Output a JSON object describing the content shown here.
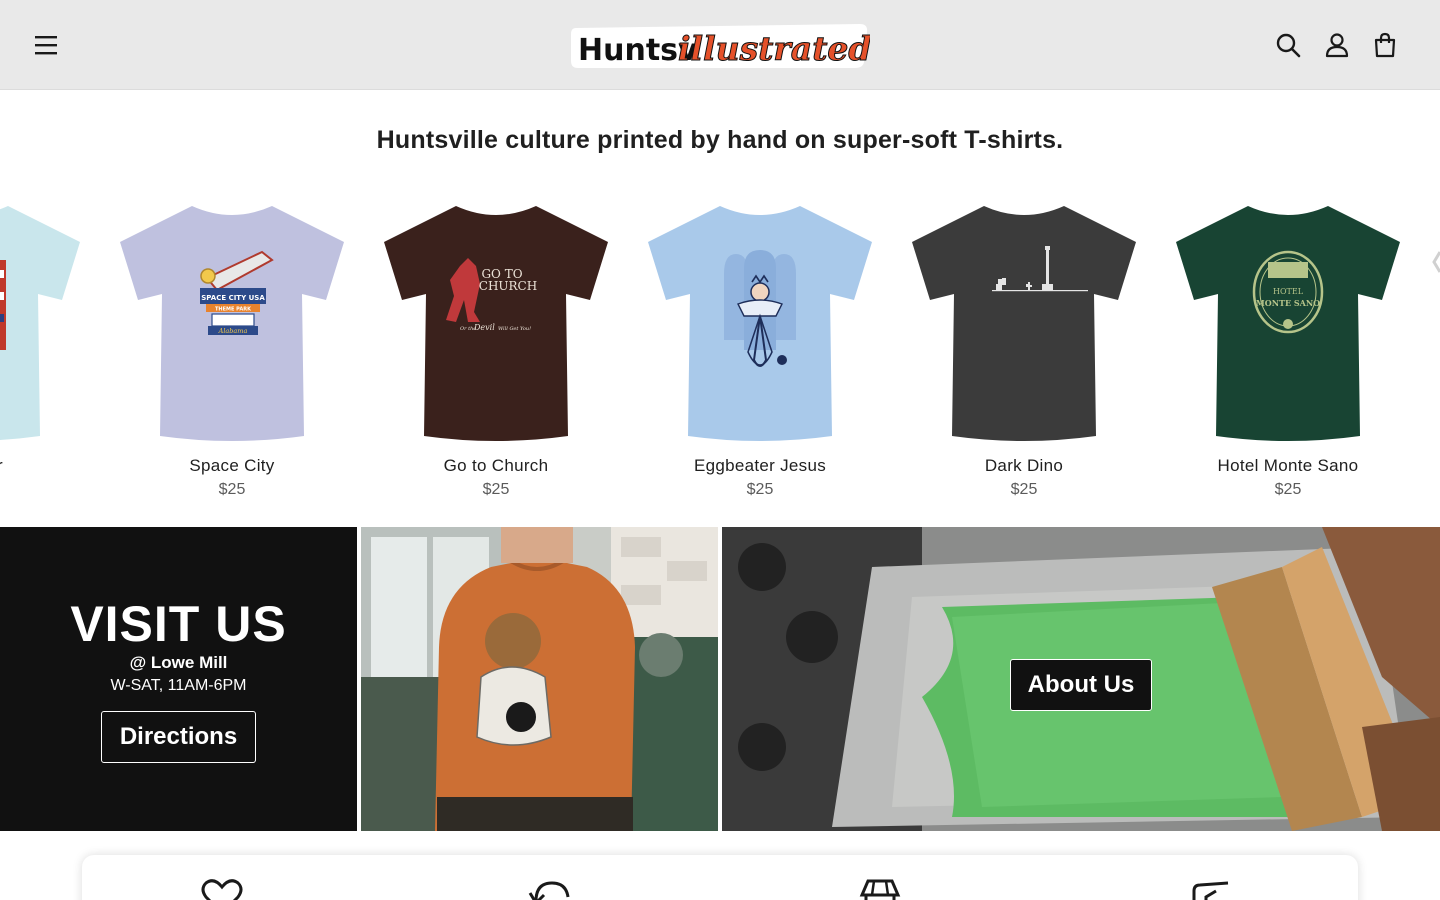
{
  "header": {
    "menu_icon": "hamburger-menu-icon",
    "logo_text_plain": "Huntsv",
    "logo_text_script": "illustrated",
    "icons": [
      "search-icon",
      "account-icon",
      "cart-icon"
    ]
  },
  "tagline": "Huntsville culture printed by hand on super-soft T-shirts.",
  "products": [
    {
      "name": "er",
      "price": "",
      "shirt_color": "#c9e6ec"
    },
    {
      "name": "Space City",
      "price": "$25",
      "shirt_color": "#bfc1df"
    },
    {
      "name": "Go to Church",
      "price": "$25",
      "shirt_color": "#3a211c"
    },
    {
      "name": "Eggbeater Jesus",
      "price": "$25",
      "shirt_color": "#a9c9ea"
    },
    {
      "name": "Dark Dino",
      "price": "$25",
      "shirt_color": "#3b3b3b"
    },
    {
      "name": "Hotel Monte Sano",
      "price": "$25",
      "shirt_color": "#184433"
    }
  ],
  "shirt_graphics": {
    "space_city": [
      "SPACE CITY USA",
      "THEME PARK",
      "Alabama"
    ],
    "go_to_church": [
      "GO TO",
      "CHURCH",
      "Or the",
      "Devil",
      "Will Get You!"
    ],
    "hotel_monte_sano": [
      "HOTEL",
      "MONTE SANO"
    ]
  },
  "visit": {
    "title": "VISIT US",
    "location": "@ Lowe Mill",
    "hours": "W-SAT, 11AM-6PM",
    "directions_label": "Directions"
  },
  "about": {
    "label": "About Us"
  },
  "colors": {
    "header_bg": "#e9e9e9",
    "logo_accent": "#e5512a",
    "banner_dark": "#111111",
    "screen_green": "#5dbb63"
  },
  "features": {
    "icons": [
      "heart-icon",
      "refresh-icon",
      "storefront-icon",
      "shipping-icon"
    ]
  }
}
